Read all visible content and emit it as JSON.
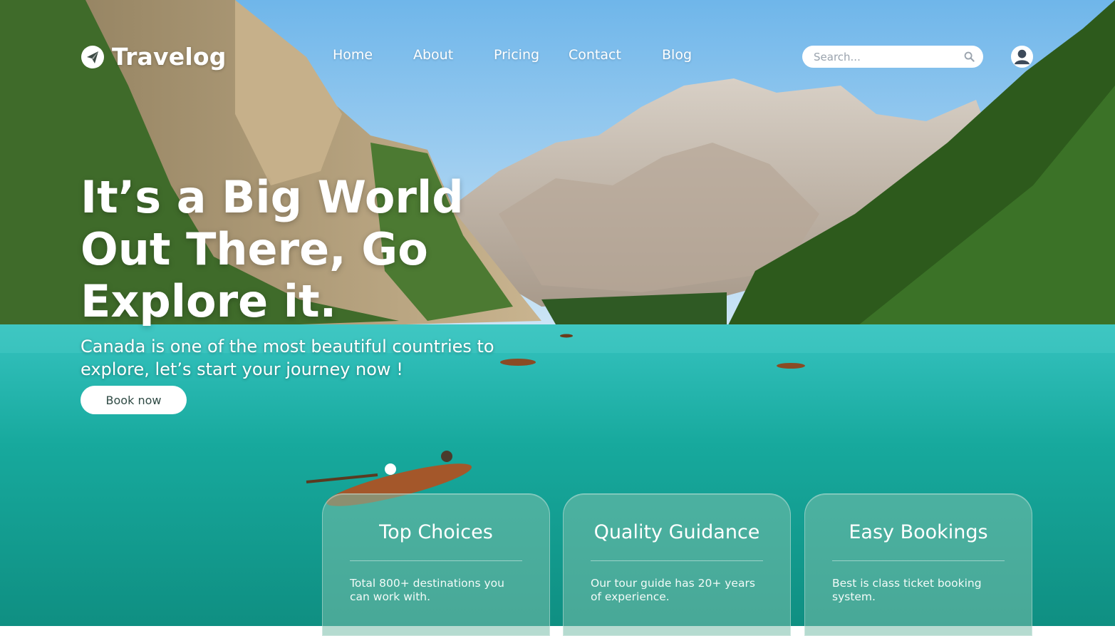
{
  "brand": {
    "name": "Travelog"
  },
  "nav": {
    "items": [
      {
        "label": "Home"
      },
      {
        "label": "About"
      },
      {
        "label": "Pricing"
      },
      {
        "label": "Contact"
      },
      {
        "label": "Blog"
      }
    ]
  },
  "search": {
    "placeholder": "Search..."
  },
  "hero": {
    "title": "It’s a Big World Out There, Go Explore it.",
    "subtitle": "Canada is one of the most beautiful countries to explore, let’s start your journey now !",
    "cta_label": "Book now"
  },
  "cards": [
    {
      "title": "Top Choices",
      "text": "Total 800+ destinations you can work with."
    },
    {
      "title": "Quality Guidance",
      "text": "Our tour guide has 20+ years of experience."
    },
    {
      "title": "Easy Bookings",
      "text": "Best is class ticket booking system."
    }
  ],
  "colors": {
    "lake": "#1fb3a6",
    "sky": "#8cc8ee",
    "forest": "#2f5a1e",
    "button_text": "#2f4a44"
  },
  "icons": {
    "logo": "paper-plane-icon",
    "search": "search-icon",
    "user": "user-icon"
  }
}
